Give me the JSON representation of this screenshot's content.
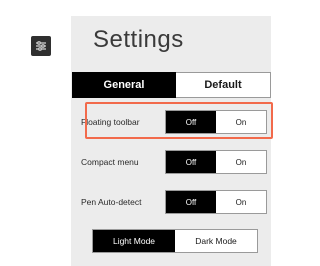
{
  "panel": {
    "title": "Settings"
  },
  "tabs": [
    {
      "label": "General",
      "selected": true
    },
    {
      "label": "Default",
      "selected": false
    }
  ],
  "settings": [
    {
      "label": "Floating toolbar",
      "off_label": "Off",
      "on_label": "On",
      "value": "Off",
      "highlighted": true
    },
    {
      "label": "Compact menu",
      "off_label": "Off",
      "on_label": "On",
      "value": "Off",
      "highlighted": false
    },
    {
      "label": "Pen Auto-detect",
      "off_label": "Off",
      "on_label": "On",
      "value": "Off",
      "highlighted": false
    }
  ],
  "mode": {
    "light_label": "Light Mode",
    "dark_label": "Dark Mode",
    "value": "Light Mode"
  },
  "icons": {
    "settings_button": "sliders-icon"
  },
  "colors": {
    "accent_active": "#000000",
    "panel_background": "#ececec",
    "highlight_border": "#f26a4b",
    "icon_button": "#2f2f2f"
  }
}
